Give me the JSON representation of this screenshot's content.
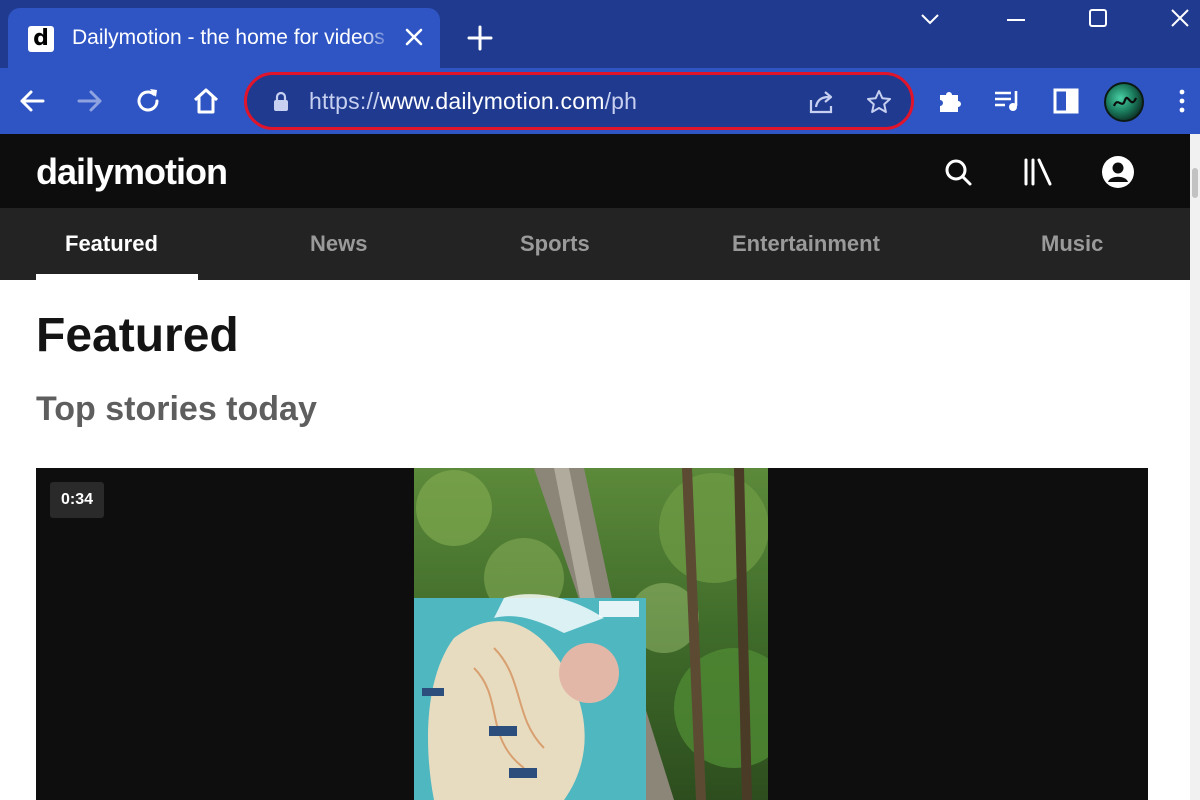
{
  "browser": {
    "tab_title": "Dailymotion - the home for videos",
    "favicon_letter": "d",
    "url_scheme": "https://",
    "url_host": "www.dailymotion.com",
    "url_path": "/ph"
  },
  "site": {
    "logo": "dailymotion",
    "nav": [
      "Featured",
      "News",
      "Sports",
      "Entertainment",
      "Music"
    ],
    "active_nav": "Featured"
  },
  "main": {
    "page_title": "Featured",
    "section_title": "Top stories today",
    "video": {
      "duration": "0:34"
    }
  },
  "colors": {
    "tab_strip": "#1f3a8f",
    "toolbar": "#2f55c4",
    "omnibox_highlight": "#e0142b",
    "site_header": "#0d0d0d",
    "site_nav": "#232323"
  }
}
